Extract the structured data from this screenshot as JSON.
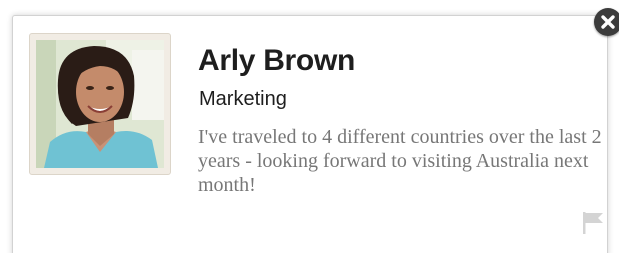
{
  "profile": {
    "name": "Arly Brown",
    "department": "Marketing",
    "bio": "I've traveled to 4 different countries over the last 2 years - looking forward to visiting Australia next month!"
  },
  "icons": {
    "close": "close-icon",
    "flag": "flag-icon"
  },
  "colors": {
    "name_text": "#1e1e1e",
    "bio_text": "#777777",
    "close_button": "#3c3c3c",
    "flag": "#d4d4d4"
  }
}
